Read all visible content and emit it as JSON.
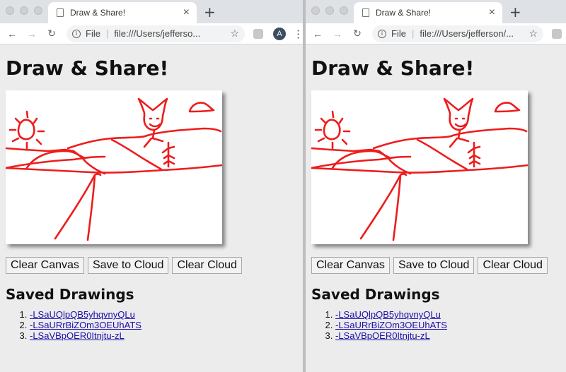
{
  "windows": [
    {
      "tab_title": "Draw & Share!",
      "address_scheme": "File",
      "address_url": "file:///Users/jefferso...",
      "avatar_letter": "A",
      "page_title": "Draw & Share!",
      "buttons": [
        "Clear Canvas",
        "Save to Cloud",
        "Clear Cloud"
      ],
      "saved_heading": "Saved Drawings",
      "saved_drawings": [
        "-LSaUQlpQB5yhqvnyQLu",
        "-LSaURrBiZOm3OEUhATS",
        "-LSaVBpOER0Itnjtu-zL"
      ]
    },
    {
      "tab_title": "Draw & Share!",
      "address_scheme": "File",
      "address_url": "file:///Users/jefferson/...",
      "page_title": "Draw & Share!",
      "buttons": [
        "Clear Canvas",
        "Save to Cloud",
        "Clear Cloud"
      ],
      "saved_heading": "Saved Drawings",
      "saved_drawings": [
        "-LSaUQlpQB5yhqvnyQLu",
        "-LSaURrBiZOm3OEUhATS",
        "-LSaVBpOER0Itnjtu-zL"
      ]
    }
  ],
  "icons": {
    "back": "arrow-left-icon",
    "forward": "arrow-right-icon",
    "reload": "reload-icon",
    "info": "info-icon",
    "bookmark": "star-icon",
    "extension": "extension-icon",
    "menu": "kebab-menu-icon",
    "close_tab": "close-icon",
    "new_tab": "plus-icon",
    "page": "document-icon"
  },
  "colors": {
    "ink": "#ee1c1c",
    "link": "#1a0dab",
    "page_bg": "#ececec"
  }
}
